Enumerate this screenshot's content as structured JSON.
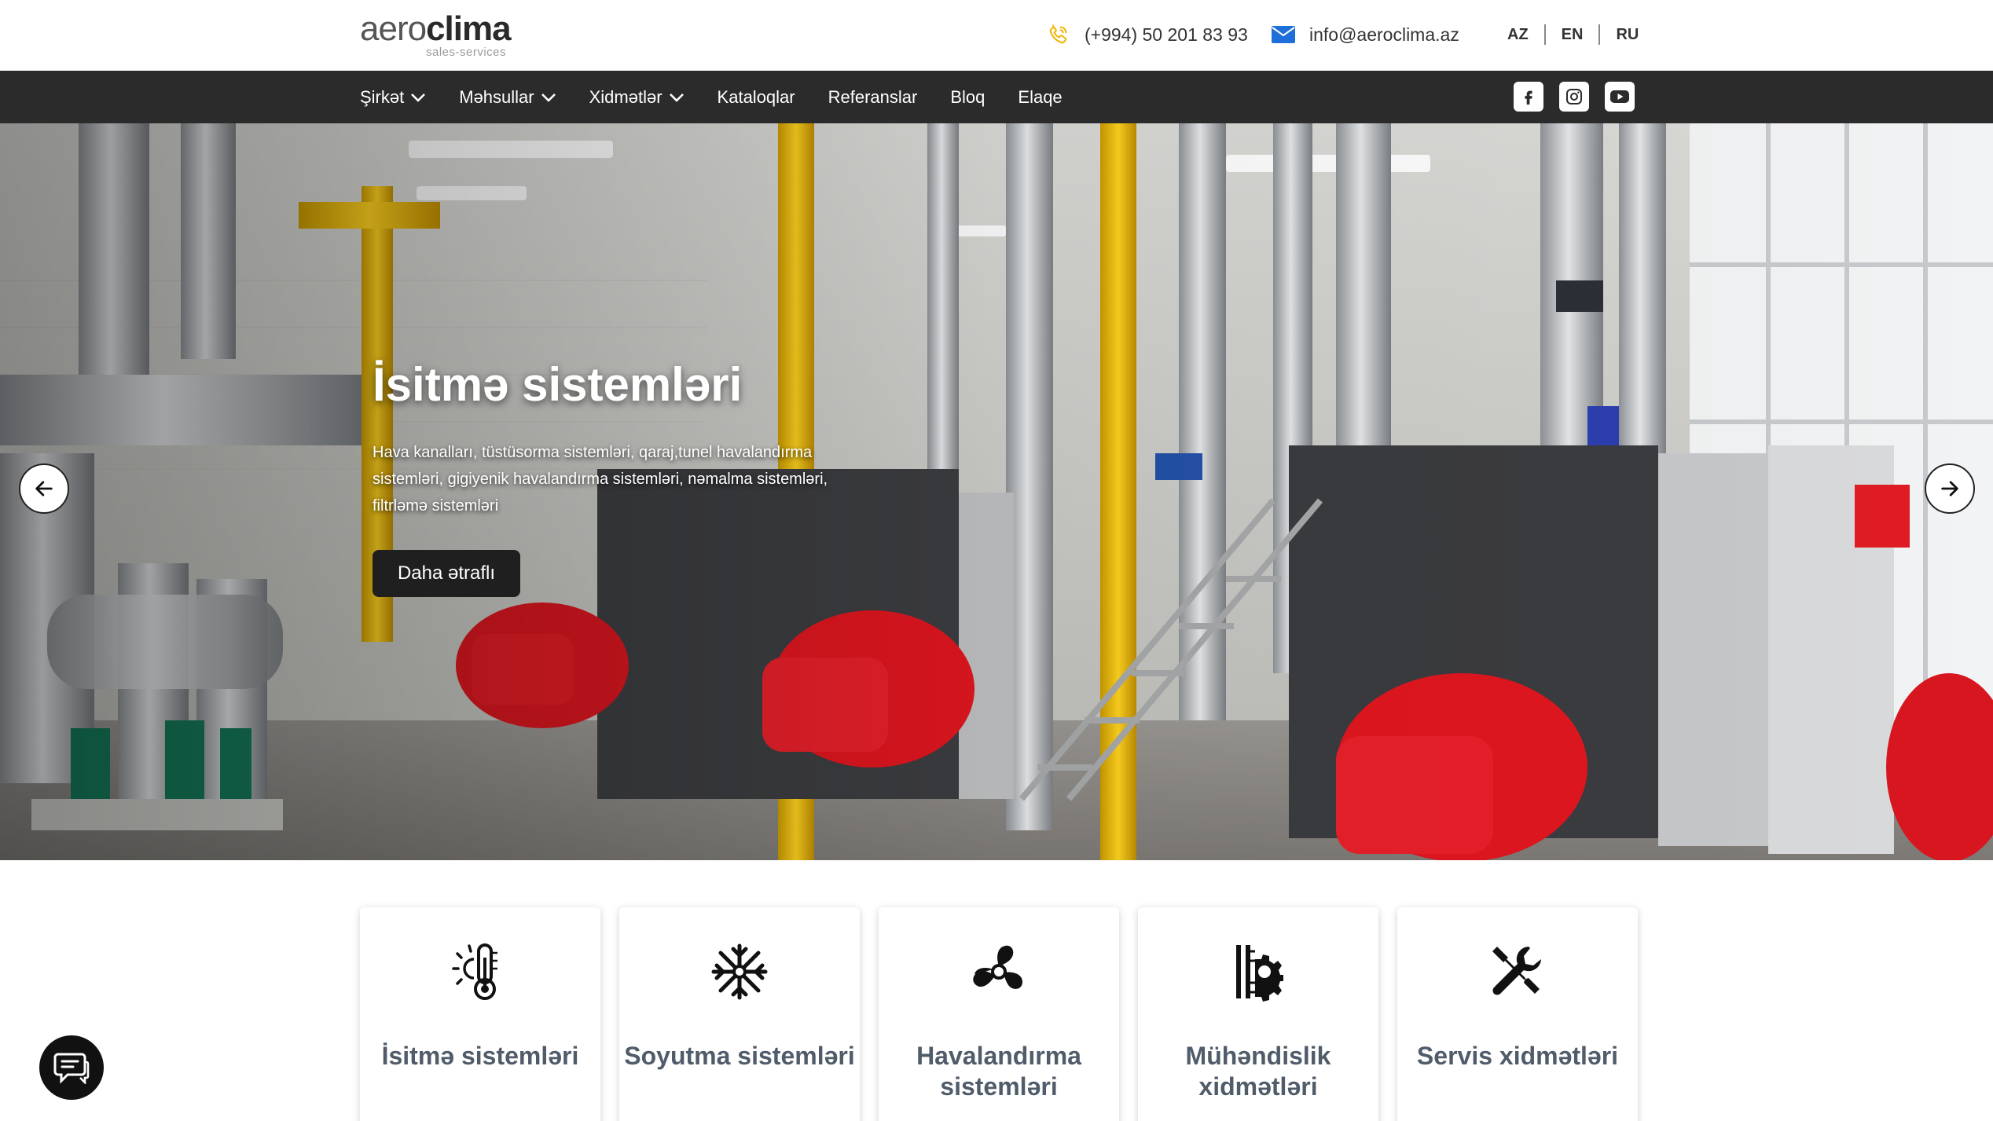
{
  "header": {
    "logo": {
      "part1": "aero",
      "part2": "clima",
      "tagline": "sales-services"
    },
    "phone": {
      "icon": "phone-icon",
      "text": "(+994) 50 201 83 93"
    },
    "email": {
      "icon": "envelope-icon",
      "text": "info@aeroclima.az"
    },
    "languages": [
      "AZ",
      "EN",
      "RU"
    ]
  },
  "nav": {
    "items": [
      {
        "label": "Şirkət",
        "dropdown": true
      },
      {
        "label": "Məhsullar",
        "dropdown": true
      },
      {
        "label": "Xidmətlər",
        "dropdown": true
      },
      {
        "label": "Kataloqlar",
        "dropdown": false
      },
      {
        "label": "Referanslar",
        "dropdown": false
      },
      {
        "label": "Bloq",
        "dropdown": false
      },
      {
        "label": "Elaqe",
        "dropdown": false
      }
    ],
    "socials": [
      "facebook-icon",
      "instagram-icon",
      "youtube-icon"
    ]
  },
  "hero": {
    "title": "İsitmə sistemləri",
    "description": "Hava kanalları, tüstüsorma sistemləri, qaraj,tunel havalandırma sistemləri, gigiyenik havalandırma sistemləri, nəmalma sistemləri, filtrləmə sistemləri",
    "button": "Daha ətraflı",
    "prev_icon": "arrow-left-icon",
    "next_icon": "arrow-right-icon"
  },
  "services": [
    {
      "icon": "thermometer-sun-icon",
      "label": "İsitmə sistemləri"
    },
    {
      "icon": "snowflake-icon",
      "label": "Soyutma sistemləri"
    },
    {
      "icon": "fan-icon",
      "label": "Havalandırma sistemləri"
    },
    {
      "icon": "engineering-gear-icon",
      "label": "Mühəndislik xidmətləri"
    },
    {
      "icon": "wrench-screwdriver-icon",
      "label": "Servis xidmətləri"
    }
  ],
  "chat": {
    "icon": "chat-icon"
  },
  "colors": {
    "navbar": "#2b2b2b",
    "accent_phone": "#f0b400",
    "accent_email": "#1e6fd9",
    "card_text": "#505c6a"
  }
}
